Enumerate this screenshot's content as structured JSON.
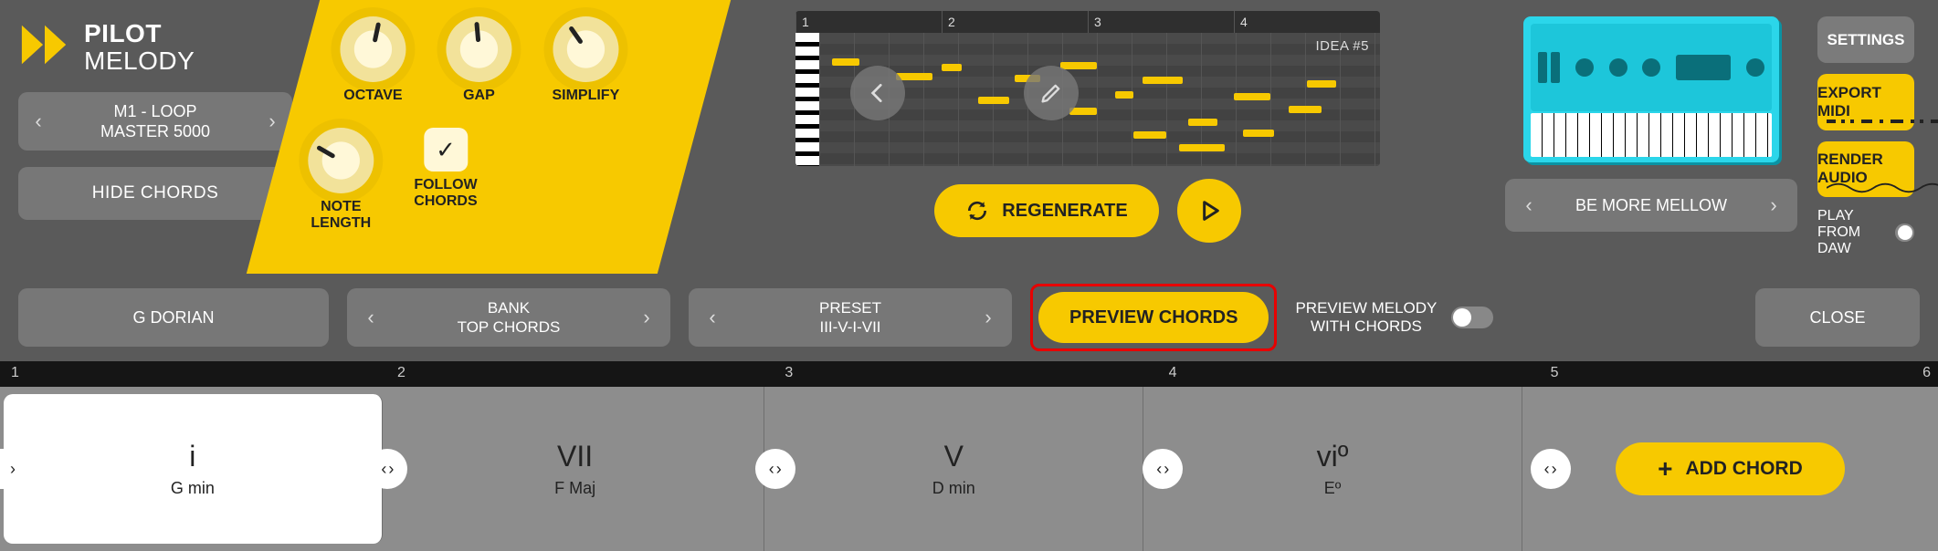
{
  "logo": {
    "line1": "PILOT",
    "line2": "MELODY"
  },
  "instrument": {
    "line1": "M1 - LOOP",
    "line2": "MASTER 5000"
  },
  "hide_chords": "HIDE CHORDS",
  "knobs": {
    "octave": "OCTAVE",
    "gap": "GAP",
    "simplify": "SIMPLIFY",
    "note_length_l1": "NOTE",
    "note_length_l2": "LENGTH",
    "follow_l1": "FOLLOW",
    "follow_l2": "CHORDS"
  },
  "roll": {
    "bars": [
      "1",
      "2",
      "3",
      "4"
    ],
    "idea": "IDEA #5"
  },
  "regenerate": "REGENERATE",
  "mellow": "BE MORE MELLOW",
  "side": {
    "settings": "SETTINGS",
    "export_midi": "EXPORT MIDI",
    "render_audio": "RENDER AUDIO",
    "play_daw": "PLAY FROM DAW"
  },
  "midbar": {
    "scale": "G DORIAN",
    "bank_l1": "BANK",
    "bank_l2": "TOP CHORDS",
    "preset_l1": "PRESET",
    "preset_l2": "III-V-I-VII",
    "preview_chords": "PREVIEW CHORDS",
    "preview_melody_l1": "PREVIEW MELODY",
    "preview_melody_l2": "WITH CHORDS",
    "close": "CLOSE"
  },
  "track": {
    "ruler": [
      "1",
      "2",
      "3",
      "4",
      "5",
      "6"
    ],
    "chords": [
      {
        "roman": "i",
        "name": "G min"
      },
      {
        "roman": "VII",
        "name": "F Maj"
      },
      {
        "roman": "V",
        "name": "D min"
      },
      {
        "roman": "viº",
        "name": "Eº"
      }
    ],
    "add_chord": "ADD CHORD"
  }
}
